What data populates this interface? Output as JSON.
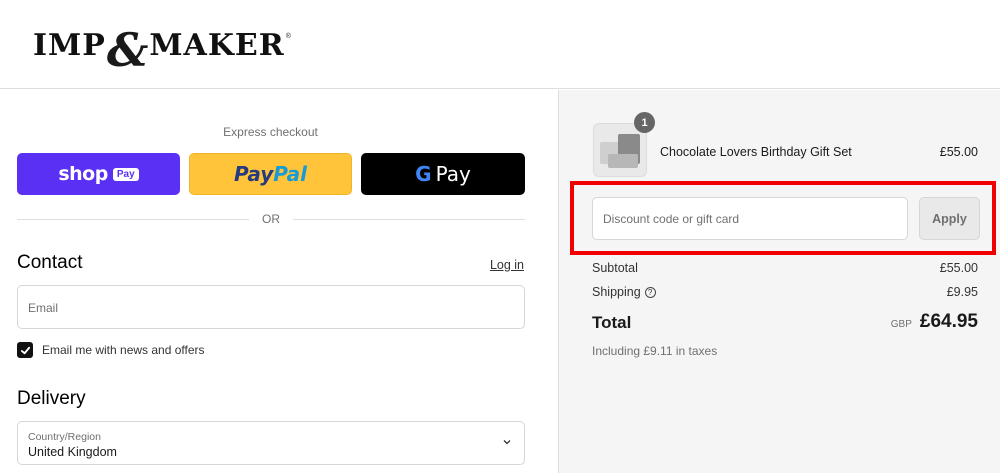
{
  "brand": {
    "left": "IMP",
    "amp": "&",
    "right": "MAKER",
    "reg": "®"
  },
  "express": {
    "label": "Express checkout",
    "shop_word": "shop",
    "shop_badge": "Pay",
    "paypal_a": "Pay",
    "paypal_b": "Pal",
    "gpay_g": "G",
    "gpay_word": "Pay",
    "or": "OR"
  },
  "contact": {
    "title": "Contact",
    "login": "Log in",
    "email_placeholder": "Email",
    "newsletter_checked": true,
    "newsletter_label": "Email me with news and offers"
  },
  "delivery": {
    "title": "Delivery",
    "country_label": "Country/Region",
    "country_value": "United Kingdom"
  },
  "summary": {
    "item": {
      "quantity": "1",
      "name": "Chocolate Lovers Birthday Gift Set",
      "price": "£55.00"
    },
    "discount_placeholder": "Discount code or gift card",
    "apply": "Apply",
    "subtotal_label": "Subtotal",
    "subtotal_value": "£55.00",
    "shipping_label": "Shipping",
    "shipping_info": "?",
    "shipping_value": "£9.95",
    "total_label": "Total",
    "currency": "GBP",
    "total_value": "£64.95",
    "taxes_note": "Including £9.11 in taxes"
  },
  "colors": {
    "shop_pay": "#5a31f4",
    "paypal": "#ffc439",
    "gpay": "#000000",
    "highlight": "#f00000",
    "summary_bg": "#f5f5f5"
  }
}
